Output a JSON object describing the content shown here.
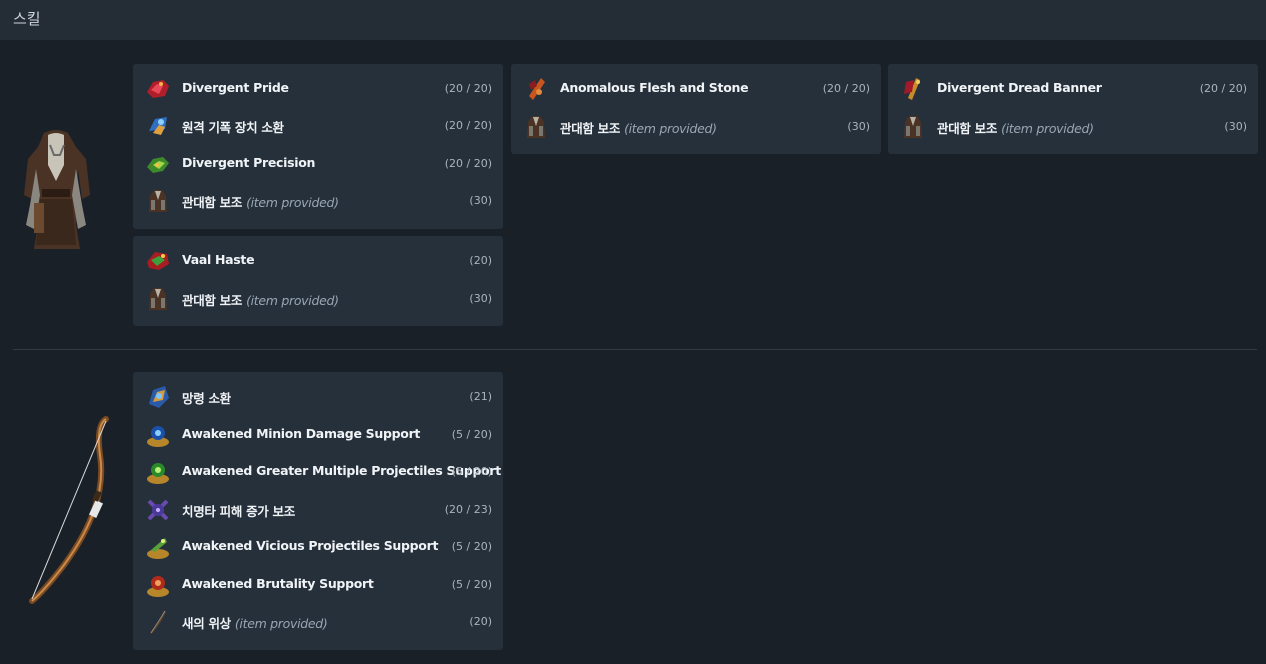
{
  "header": {
    "title": "스킬"
  },
  "groups": [
    {
      "item_icon": "body-armour-icon",
      "cards": [
        {
          "rows": [
            {
              "name": "Divergent Pride",
              "provided": "",
              "level": "(20 / 20)",
              "icon": "red-aura-gem-icon"
            },
            {
              "name": "원격 기폭 장치 소환",
              "provided": "",
              "level": "(20 / 20)",
              "icon": "blue-mine-gem-icon"
            },
            {
              "name": "Divergent Precision",
              "provided": "",
              "level": "(20 / 20)",
              "icon": "green-aura-gem-icon"
            },
            {
              "name": "관대함 보조",
              "provided": "(item provided)",
              "level": "(30)",
              "icon": "item-provided-armour-icon"
            }
          ]
        },
        {
          "rows": [
            {
              "name": "Vaal Haste",
              "provided": "",
              "level": "(20)",
              "icon": "vaal-haste-gem-icon"
            },
            {
              "name": "관대함 보조",
              "provided": "(item provided)",
              "level": "(30)",
              "icon": "item-provided-armour-icon"
            }
          ]
        },
        {
          "rows": [
            {
              "name": "Anomalous Flesh and Stone",
              "provided": "",
              "level": "(20 / 20)",
              "icon": "flesh-stone-gem-icon"
            },
            {
              "name": "관대함 보조",
              "provided": "(item provided)",
              "level": "(30)",
              "icon": "item-provided-armour-icon"
            }
          ]
        },
        {
          "rows": [
            {
              "name": "Divergent Dread Banner",
              "provided": "",
              "level": "(20 / 20)",
              "icon": "banner-gem-icon"
            },
            {
              "name": "관대함 보조",
              "provided": "(item provided)",
              "level": "(30)",
              "icon": "item-provided-armour-icon"
            }
          ]
        }
      ]
    },
    {
      "item_icon": "bow-icon",
      "cards": [
        {
          "rows": [
            {
              "name": "망령 소환",
              "provided": "",
              "level": "(21)",
              "icon": "spectre-gem-icon"
            },
            {
              "name": "Awakened Minion Damage Support",
              "provided": "",
              "level": "(5 / 20)",
              "icon": "awakened-blue-support-icon"
            },
            {
              "name": "Awakened Greater Multiple Projectiles Support",
              "provided": "",
              "level": "(5 / 20)",
              "icon": "awakened-green-support-icon"
            },
            {
              "name": "치명타 피해 증가 보조",
              "provided": "",
              "level": "(20 / 23)",
              "icon": "purple-support-icon"
            },
            {
              "name": "Awakened Vicious Projectiles Support",
              "provided": "",
              "level": "(5 / 20)",
              "icon": "awakened-green-support-icon"
            },
            {
              "name": "Awakened Brutality Support",
              "provided": "",
              "level": "(5 / 20)",
              "icon": "awakened-red-support-icon"
            },
            {
              "name": "새의 위상",
              "provided": "(item provided)",
              "level": "(20)",
              "icon": "item-provided-bow-icon"
            }
          ]
        }
      ]
    }
  ]
}
